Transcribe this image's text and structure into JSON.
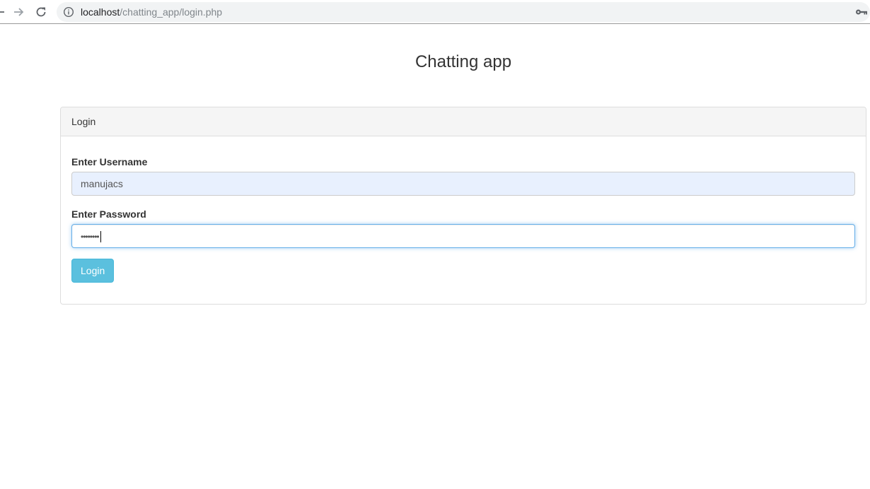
{
  "browser": {
    "url_host": "localhost",
    "url_path": "/chatting_app/login.php",
    "icons": {
      "back": "arrow-left-icon",
      "forward": "arrow-right-icon",
      "reload": "reload-icon",
      "site_info": "info-icon",
      "password_key": "key-icon"
    }
  },
  "page": {
    "title": "Chatting app"
  },
  "login_panel": {
    "heading": "Login",
    "username_label": "Enter Username",
    "username_value": "manujacs",
    "password_label": "Enter Password",
    "password_masked": "••••••••",
    "button_label": "Login"
  },
  "colors": {
    "button_bg": "#5bc0de",
    "autofill_bg": "#e8f0fe",
    "focus_border": "#66afe9"
  }
}
